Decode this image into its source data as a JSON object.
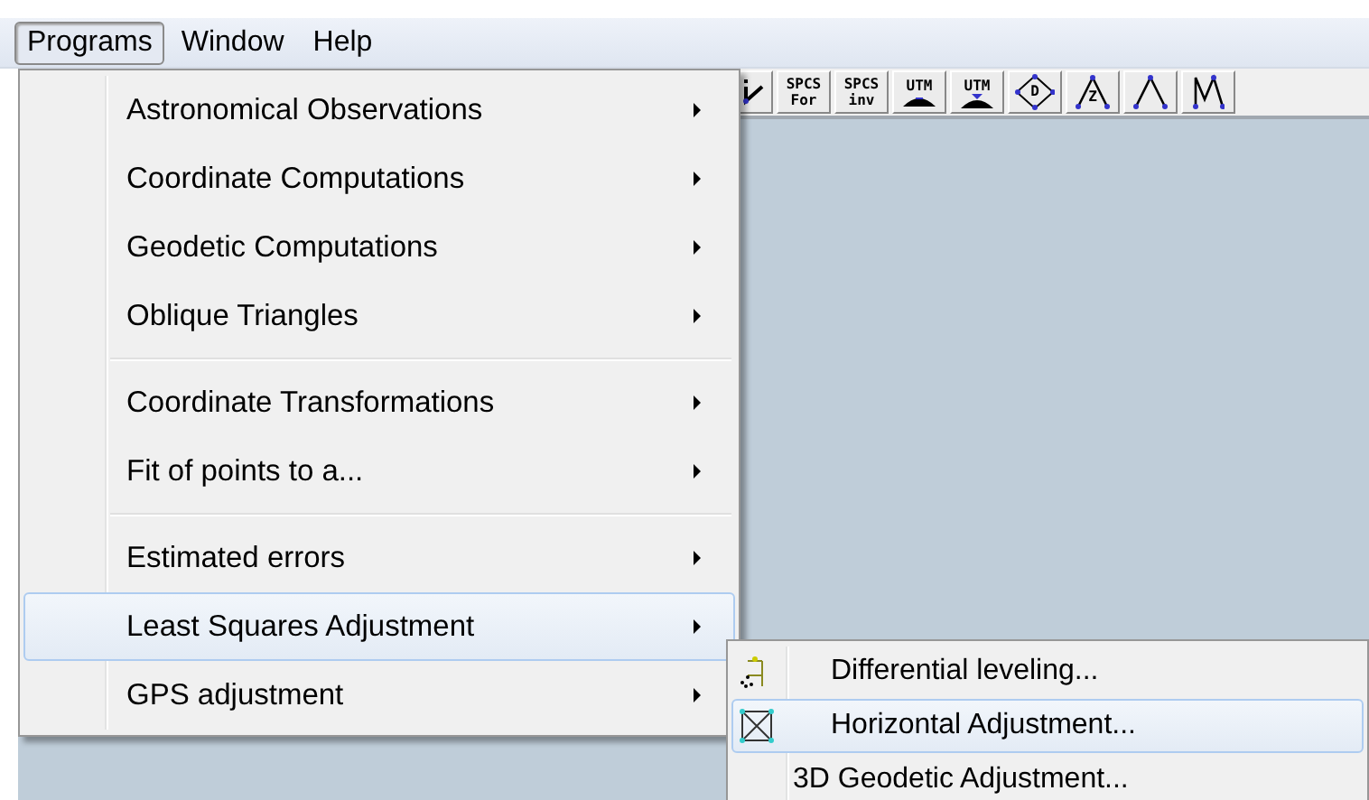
{
  "menu_bar": [
    {
      "label": "Programs",
      "selected": true
    },
    {
      "label": "Window",
      "selected": false
    },
    {
      "label": "Help",
      "selected": false
    }
  ],
  "toolbar": [
    {
      "kind": "check-graph"
    },
    {
      "kind": "text",
      "lines": [
        "SPCS",
        "For"
      ]
    },
    {
      "kind": "text",
      "lines": [
        "SPCS",
        "inv"
      ]
    },
    {
      "kind": "mound-up",
      "label": "UTM"
    },
    {
      "kind": "mound-down",
      "label": "UTM"
    },
    {
      "kind": "diamond",
      "label": "D"
    },
    {
      "kind": "triangle",
      "label": "Z"
    },
    {
      "kind": "triangle"
    },
    {
      "kind": "zigzag"
    }
  ],
  "programs_menu": [
    {
      "kind": "item",
      "label": "Astronomical Observations",
      "submenu": true,
      "selected": false
    },
    {
      "kind": "item",
      "label": "Coordinate Computations",
      "submenu": true,
      "selected": false
    },
    {
      "kind": "item",
      "label": "Geodetic Computations",
      "submenu": true,
      "selected": false
    },
    {
      "kind": "item",
      "label": "Oblique Triangles",
      "submenu": true,
      "selected": false
    },
    {
      "kind": "separator"
    },
    {
      "kind": "item",
      "label": "Coordinate Transformations",
      "submenu": true,
      "selected": false
    },
    {
      "kind": "item",
      "label": "Fit of points to a...",
      "submenu": true,
      "selected": false
    },
    {
      "kind": "separator"
    },
    {
      "kind": "item",
      "label": "Estimated errors",
      "submenu": true,
      "selected": false
    },
    {
      "kind": "item",
      "label": "Least Squares Adjustment",
      "submenu": true,
      "selected": true
    },
    {
      "kind": "item",
      "label": "GPS adjustment",
      "submenu": true,
      "selected": false
    }
  ],
  "adjustment_submenu": [
    {
      "kind": "leveling",
      "label": "Differential leveling...",
      "selected": false
    },
    {
      "kind": "network",
      "label": "Horizontal Adjustment...",
      "selected": true
    },
    {
      "kind": "plain",
      "label": "3D Geodetic Adjustment...",
      "selected": false
    }
  ]
}
